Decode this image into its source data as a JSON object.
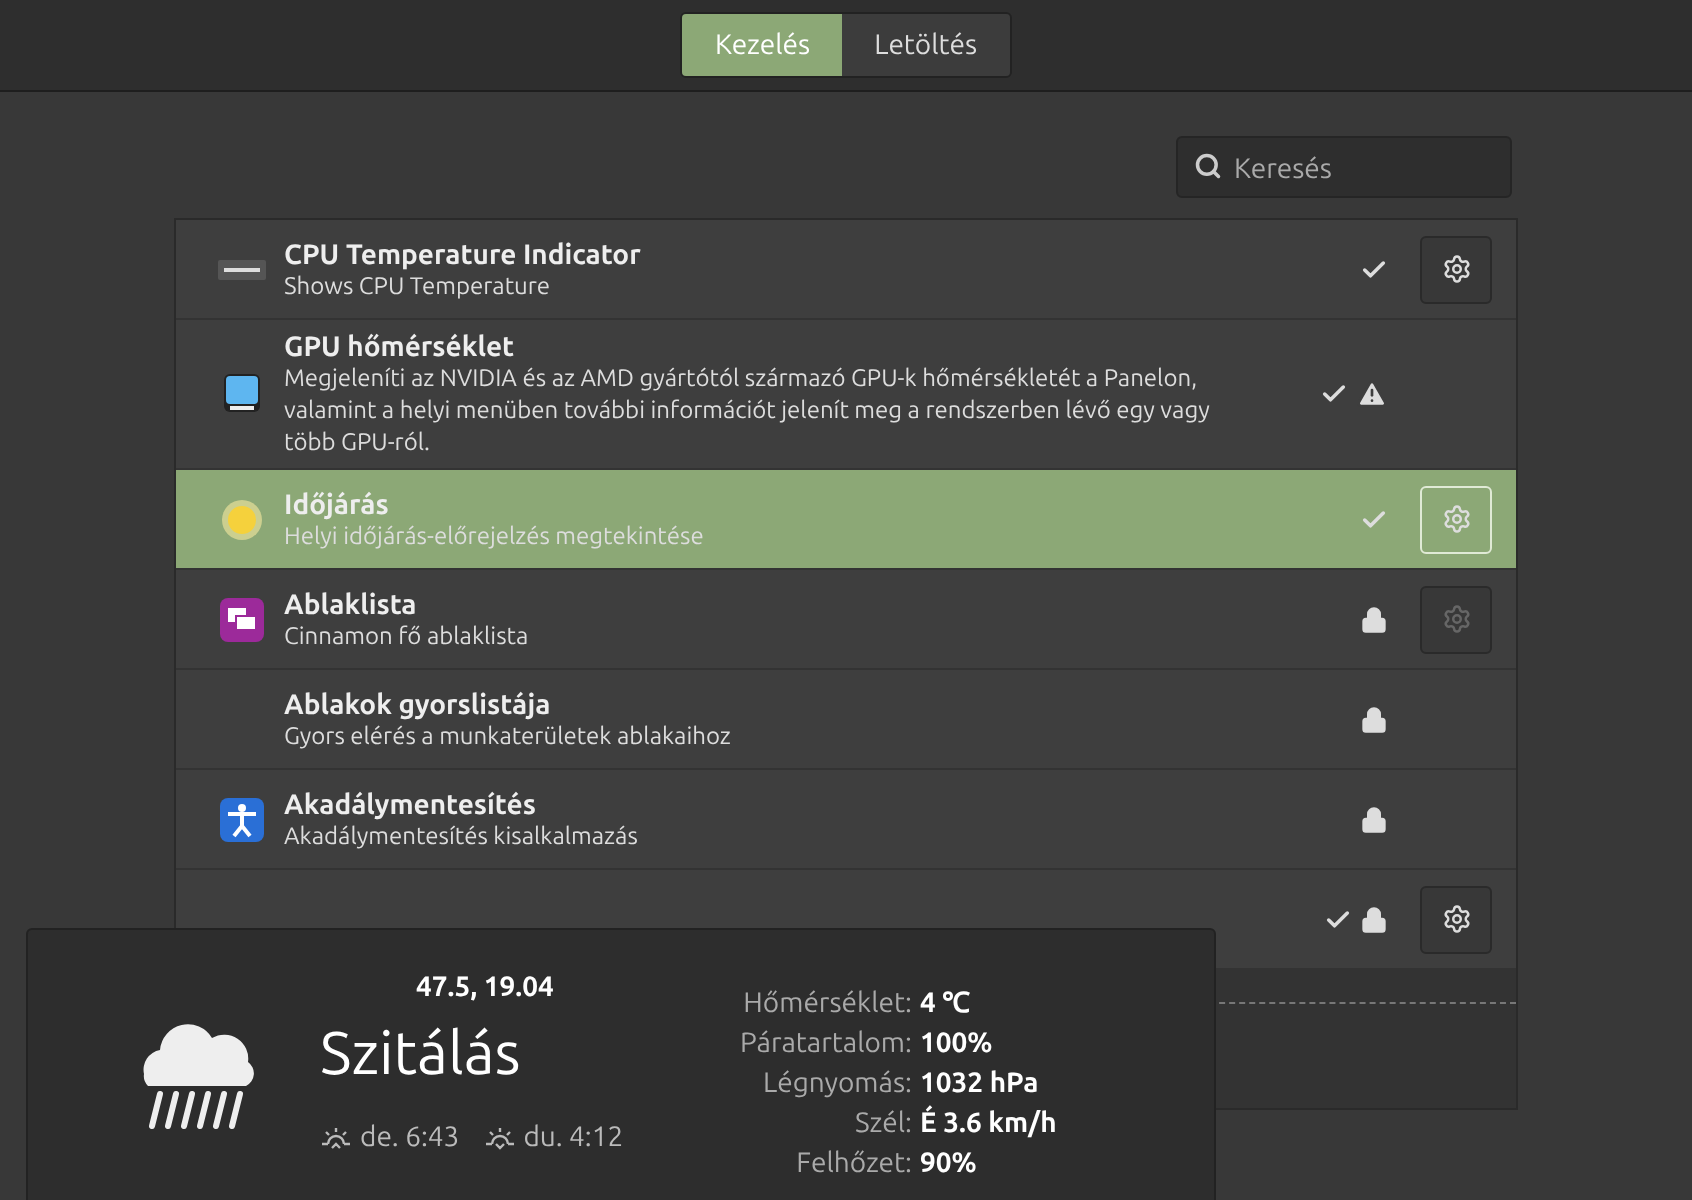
{
  "tabs": [
    {
      "label": "Kezelés",
      "selected": true
    },
    {
      "label": "Letöltés",
      "selected": false
    }
  ],
  "search": {
    "placeholder": "Keresés"
  },
  "applets": [
    {
      "kind": "thermo",
      "title": "CPU Temperature Indicator",
      "description": "Shows CPU Temperature",
      "selected": false,
      "enabled": true,
      "locked": false,
      "warning": false,
      "configurable": true,
      "settings_disabled": false
    },
    {
      "kind": "gpu",
      "title": "GPU hőmérséklet",
      "description": "Megjeleníti az NVIDIA és az AMD gyártótól származó GPU-k hőmérsékletét a Panelon, valamint a helyi menüben további információt jelenít meg a rendszerben lévő egy vagy több GPU-ról.",
      "selected": false,
      "enabled": true,
      "locked": false,
      "warning": true,
      "configurable": false,
      "settings_disabled": false
    },
    {
      "kind": "sun",
      "title": "Időjárás",
      "description": "Helyi időjárás-előrejelzés megtekintése",
      "selected": true,
      "enabled": true,
      "locked": false,
      "warning": false,
      "configurable": true,
      "settings_disabled": false
    },
    {
      "kind": "windows",
      "title": "Ablaklista",
      "description": "Cinnamon fő ablaklista",
      "selected": false,
      "enabled": false,
      "locked": true,
      "warning": false,
      "configurable": true,
      "settings_disabled": true
    },
    {
      "kind": "plain",
      "title": "Ablakok gyorslistája",
      "description": "Gyors elérés a munkaterületek ablakaihoz",
      "selected": false,
      "enabled": false,
      "locked": true,
      "warning": false,
      "configurable": false,
      "settings_disabled": false
    },
    {
      "kind": "access",
      "title": "Akadálymentesítés",
      "description": "Akadálymentesítés kisalkalmazás",
      "selected": false,
      "enabled": false,
      "locked": true,
      "warning": false,
      "configurable": false,
      "settings_disabled": false
    },
    {
      "kind": "plain",
      "selected": false,
      "enabled": true,
      "locked": true,
      "warning": false,
      "configurable": true,
      "settings_disabled": false
    }
  ],
  "weather_popup": {
    "coordinates": "47.5, 19.04",
    "condition": "Szitálás",
    "sunrise": "de. 6:43",
    "sunset": "du. 4:12",
    "details": [
      {
        "label": "Hőmérséklet:",
        "value": "4 ℃"
      },
      {
        "label": "Páratartalom:",
        "value": "100%"
      },
      {
        "label": "Légnyomás:",
        "value": "1032 hPa"
      },
      {
        "label": "Szél:",
        "value": "É 3.6 km/h"
      },
      {
        "label": "Felhőzet:",
        "value": "90%"
      }
    ]
  }
}
